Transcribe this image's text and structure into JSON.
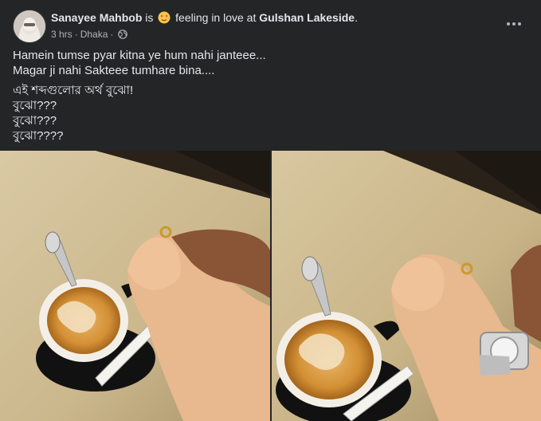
{
  "post": {
    "author": "Sanayee Mahbob",
    "is_word": "is",
    "feeling_text": "feeling in love at",
    "place": "Gulshan Lakeside",
    "period": ".",
    "time": "3 hrs",
    "location": "Dhaka",
    "dot": "·",
    "lines": [
      "Hamein tumse pyar kitna ye hum nahi janteee...",
      "Magar ji nahi Sakteee tumhare bina....",
      "এই শব্দগুলোর অর্থ বুঝো!",
      "বুঝো???",
      "বুঝো???",
      "বুঝো????"
    ]
  },
  "icons": {
    "feeling": "in-love-emoji-icon",
    "audience": "globe-icon",
    "more": "more-options-icon"
  },
  "colors": {
    "background": "#242526",
    "text": "#e4e6eb",
    "secondary": "#b0b3b8"
  }
}
